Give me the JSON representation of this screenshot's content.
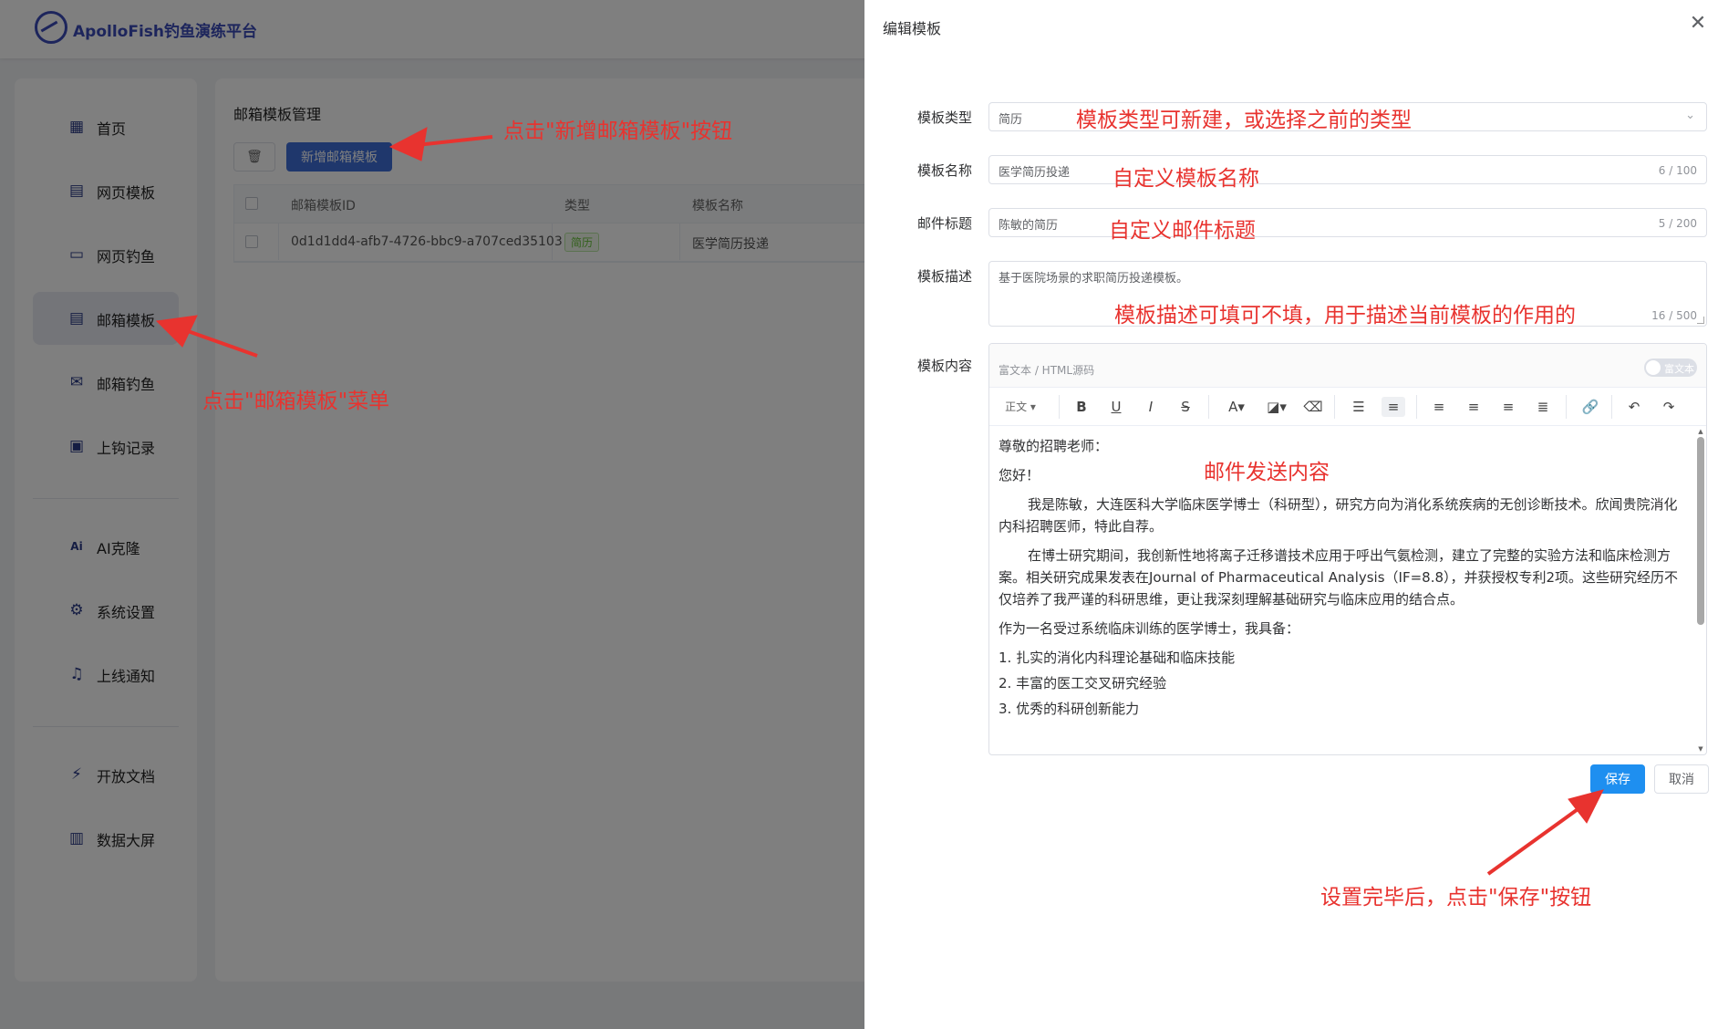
{
  "app": {
    "title": "ApolloFish钓鱼演练平台"
  },
  "sidebar": {
    "items": [
      {
        "label": "首页",
        "icon": "grid-icon"
      },
      {
        "label": "网页模板",
        "icon": "document-icon"
      },
      {
        "label": "网页钓鱼",
        "icon": "browser-icon"
      },
      {
        "label": "邮箱模板",
        "icon": "document-icon"
      },
      {
        "label": "邮箱钓鱼",
        "icon": "mail-icon"
      },
      {
        "label": "上钩记录",
        "icon": "calendar-icon"
      },
      {
        "label": "AI克隆",
        "icon": "ai-icon"
      },
      {
        "label": "系统设置",
        "icon": "gear-icon"
      },
      {
        "label": "上线通知",
        "icon": "bell-icon"
      },
      {
        "label": "开放文档",
        "icon": "plug-icon"
      },
      {
        "label": "数据大屏",
        "icon": "chart-icon"
      }
    ],
    "active": "邮箱模板"
  },
  "content": {
    "title": "邮箱模板管理",
    "add_button": "新增邮箱模板",
    "delete_icon": "trash-icon",
    "table": {
      "columns": [
        "邮箱模板ID",
        "类型",
        "模板名称"
      ],
      "rows": [
        {
          "id": "0d1d1dd4-afb7-4726-bbc9-a707ced35103",
          "type": "简历",
          "name": "医学简历投递"
        }
      ]
    }
  },
  "drawer": {
    "title": "编辑模板",
    "close_icon": "close-icon",
    "fields": {
      "type": {
        "label": "模板类型",
        "value": "简历"
      },
      "name": {
        "label": "模板名称",
        "value": "医学简历投递",
        "count": "6 / 100"
      },
      "subject": {
        "label": "邮件标题",
        "value": "陈敏的简历",
        "count": "5 / 200"
      },
      "desc": {
        "label": "模板描述",
        "value": "基于医院场景的求职简历投递模板。",
        "count": "16 / 500"
      },
      "content": {
        "label": "模板内容"
      }
    },
    "editor": {
      "mode": "富文本 / HTML源码",
      "switch_text": "富文本",
      "heading": "正文",
      "body": {
        "p1": "尊敬的招聘老师：",
        "p2": "您好！",
        "p3": "我是陈敏，大连医科大学临床医学博士（科研型），研究方向为消化系统疾病的无创诊断技术。欣闻贵院消化内科招聘医师，特此自荐。",
        "p4": "在博士研究期间，我创新性地将离子迁移谱技术应用于呼出气氨检测，建立了完整的实验方法和临床检测方案。相关研究成果发表在Journal of Pharmaceutical Analysis（IF=8.8），并获授权专利2项。这些研究经历不仅培养了我严谨的科研思维，更让我深刻理解基础研究与临床应用的结合点。",
        "p5": "作为一名受过系统临床训练的医学博士，我具备：",
        "list": [
          "1.  扎实的消化内科理论基础和临床技能",
          "2.  丰富的医工交叉研究经验",
          "3.  优秀的科研创新能力"
        ]
      }
    },
    "save": "保存",
    "cancel": "取消"
  },
  "annotations": {
    "add_button_hint": "点击\"新增邮箱模板\"按钮",
    "menu_hint": "点击\"邮箱模板\"菜单",
    "type_hint": "模板类型可新建，或选择之前的类型",
    "name_hint": "自定义模板名称",
    "subject_hint": "自定义邮件标题",
    "desc_hint": "模板描述可填可不填，用于描述当前模板的作用的",
    "content_hint": "邮件发送内容",
    "save_hint": "设置完毕后，点击\"保存\"按钮",
    "color": "#e8332f"
  },
  "colors": {
    "primary": "#3f6fd8",
    "save": "#1e8ff0",
    "brand": "#3b4bb8"
  }
}
